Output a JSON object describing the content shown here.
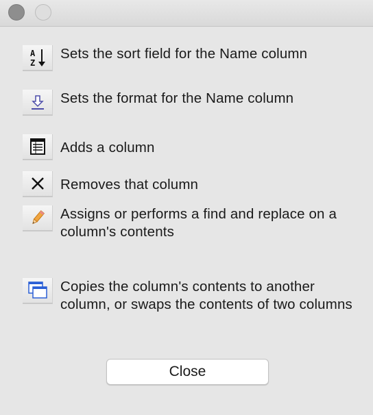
{
  "items": [
    {
      "icon": "sort-az-icon",
      "text": "Sets the sort field for the Name column"
    },
    {
      "icon": "format-arrow-icon",
      "text": "Sets the format for the Name column"
    },
    {
      "icon": "add-column-icon",
      "text": "Adds a column"
    },
    {
      "icon": "remove-x-icon",
      "text": "Removes that column"
    },
    {
      "icon": "pencil-icon",
      "text": "Assigns or performs a find and replace on a column's contents"
    },
    {
      "icon": "copy-windows-icon",
      "text": "Copies the column's contents to another column, or swaps the contents of two columns"
    }
  ],
  "close_label": "Close"
}
